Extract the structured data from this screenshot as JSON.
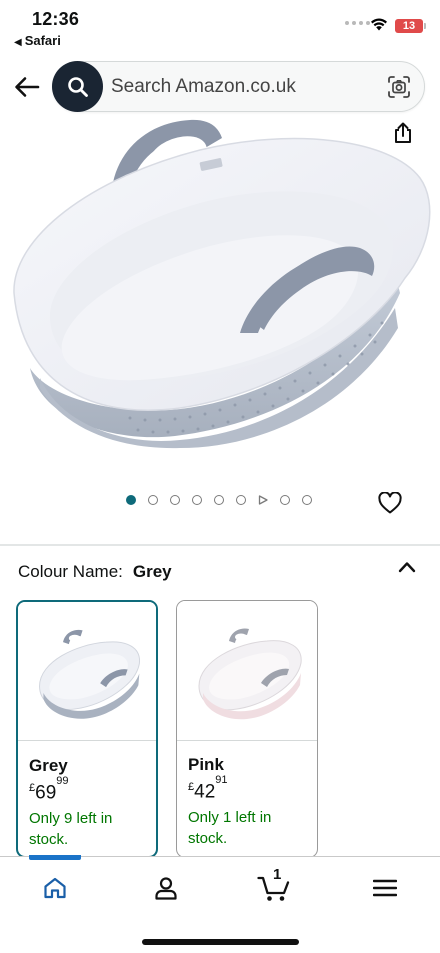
{
  "status_bar": {
    "time": "12:36",
    "back_app": "Safari",
    "battery": "13",
    "battery_color": "#e04a4a"
  },
  "search": {
    "placeholder": "Search Amazon.co.uk",
    "icons": [
      "back-arrow-icon",
      "search-icon",
      "camera-scan-icon"
    ]
  },
  "product": {
    "image": "grey-moses-basket",
    "share_icon": "share-icon",
    "wishlist_icon": "heart-icon",
    "carousel": {
      "active_index": 0,
      "items": [
        "image",
        "image",
        "image",
        "image",
        "image",
        "video",
        "image",
        "image"
      ]
    }
  },
  "variant": {
    "label": "Colour Name:",
    "selected": "Grey",
    "accent": "#0e6a7a",
    "options": [
      {
        "name": "Grey",
        "currency": "£",
        "price_major": "69",
        "price_minor": "99",
        "stock": "Only 9 left in stock."
      },
      {
        "name": "Pink",
        "currency": "£",
        "price_major": "42",
        "price_minor": "91",
        "stock": "Only 1 left in stock."
      }
    ],
    "stock_color": "#007600"
  },
  "bottom_nav": {
    "items": [
      "home-icon",
      "account-icon",
      "cart-icon",
      "menu-icon"
    ],
    "cart_count": "1",
    "active": "home"
  }
}
